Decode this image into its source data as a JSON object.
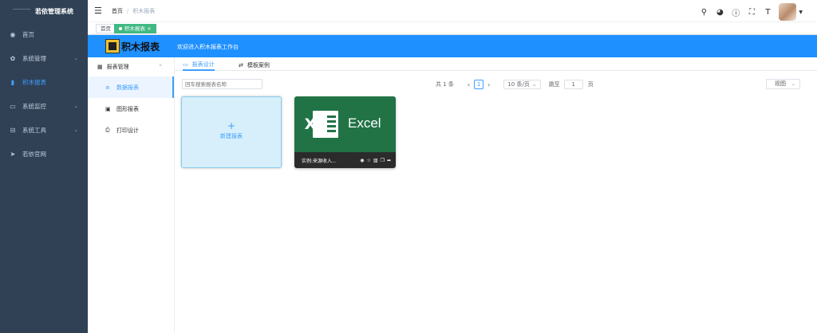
{
  "app": {
    "title": "若依管理系统"
  },
  "sidebar": {
    "items": [
      {
        "label": "首页",
        "icon": "dashboard-icon",
        "glyph": "◉",
        "has_children": false,
        "active": false
      },
      {
        "label": "系统管理",
        "icon": "gear-icon",
        "glyph": "✿",
        "has_children": true,
        "active": false
      },
      {
        "label": "积木报表",
        "icon": "bar-chart-icon",
        "glyph": "▮",
        "has_children": false,
        "active": true
      },
      {
        "label": "系统监控",
        "icon": "monitor-icon",
        "glyph": "▭",
        "has_children": true,
        "active": false
      },
      {
        "label": "系统工具",
        "icon": "toolbox-icon",
        "glyph": "⊟",
        "has_children": true,
        "active": false
      },
      {
        "label": "若依官网",
        "icon": "send-icon",
        "glyph": "➤",
        "has_children": false,
        "active": false
      }
    ]
  },
  "header": {
    "breadcrumb": [
      "首页",
      "积木报表"
    ],
    "icons": [
      "search-icon",
      "github-icon",
      "question-icon",
      "fullscreen-icon",
      "font-size-icon"
    ]
  },
  "tags": [
    {
      "label": "首页",
      "active": false
    },
    {
      "label": "积木报表",
      "active": true
    }
  ],
  "banner": {
    "brand": "积木报表",
    "welcome": "欢迎进入积木报表工作台"
  },
  "submenu": {
    "group_label": "报表管理",
    "items": [
      {
        "label": "数据报表",
        "icon": "list-icon",
        "active": true
      },
      {
        "label": "图形报表",
        "icon": "picture-icon",
        "active": false
      },
      {
        "label": "打印设计",
        "icon": "printer-icon",
        "active": false
      }
    ]
  },
  "tabs": [
    {
      "label": "报表设计",
      "icon": "monitor-icon",
      "active": true
    },
    {
      "label": "模板案例",
      "icon": "sliders-icon",
      "active": false
    }
  ],
  "toolbar": {
    "search_placeholder": "回车搜索报表名称",
    "total": "共 1 条",
    "current_page": "1",
    "page_size": "10 条/页",
    "goto_label": "跳至",
    "goto_value": "1",
    "page_unit": "页",
    "view_label": "视图"
  },
  "cards": {
    "new_label": "新建报表",
    "excel_logo": "Excel",
    "excel_name": "实例:来源收入..."
  },
  "colors": {
    "sidebar_bg": "#304156",
    "accent": "#409eff",
    "banner": "#1e90ff",
    "tag_active": "#42b983",
    "excel_green": "#217346"
  }
}
